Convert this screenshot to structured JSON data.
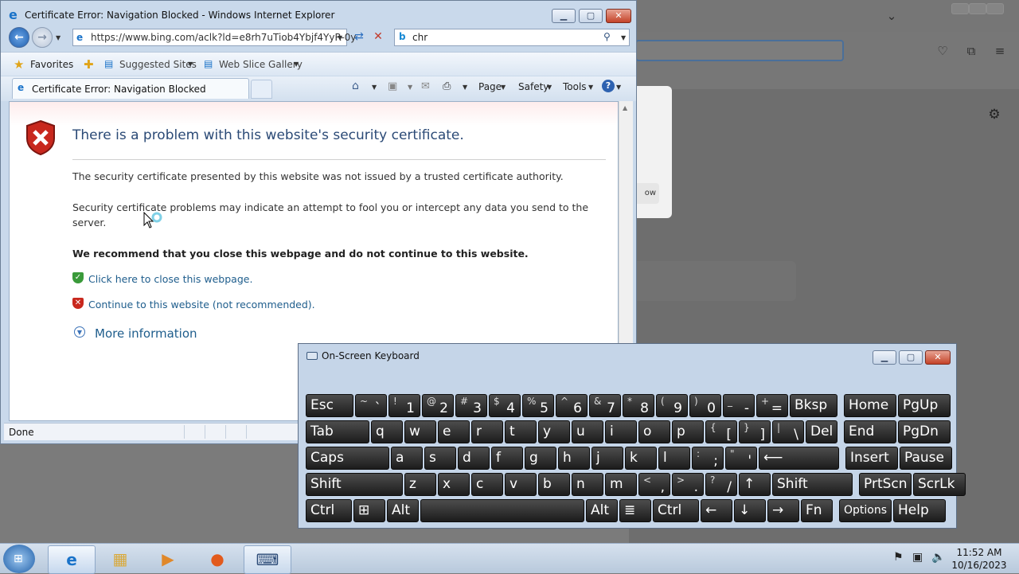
{
  "ie": {
    "title": "Certificate Error: Navigation Blocked - Windows Internet Explorer",
    "address": "https://www.bing.com/aclk?ld=e8rh7uTiob4Ybjf4YyR-0y",
    "search": "chr",
    "favorites": "Favorites",
    "suggested_sites": "Suggested Sites",
    "web_slice_gallery": "Web Slice Gallery",
    "tab_title": "Certificate Error: Navigation Blocked",
    "menu": {
      "page": "Page",
      "safety": "Safety",
      "tools": "Tools"
    },
    "heading": "There is a problem with this website's security certificate.",
    "para1": "The security certificate presented by this website was not issued by a trusted certificate authority.",
    "para2": "Security certificate problems may indicate an attempt to fool you or intercept any data you send to the server.",
    "recommend": "We recommend that you close this webpage and do not continue to this website.",
    "link_close": "Click here to close this webpage.",
    "link_continue": "Continue to this website (not recommended).",
    "more_info": "More information",
    "status": "Done"
  },
  "firefox": {
    "card_button": "ow"
  },
  "osk": {
    "title": "On-Screen Keyboard",
    "rows": [
      [
        {
          "m": "Esc"
        },
        {
          "s": "~",
          "m": "`"
        },
        {
          "s": "!",
          "m": "1"
        },
        {
          "s": "@",
          "m": "2"
        },
        {
          "s": "#",
          "m": "3"
        },
        {
          "s": "$",
          "m": "4"
        },
        {
          "s": "%",
          "m": "5"
        },
        {
          "s": "^",
          "m": "6"
        },
        {
          "s": "&",
          "m": "7"
        },
        {
          "s": "*",
          "m": "8"
        },
        {
          "s": "(",
          "m": "9"
        },
        {
          "s": ")",
          "m": "0"
        },
        {
          "s": "_",
          "m": "-"
        },
        {
          "s": "+",
          "m": "="
        },
        {
          "m": "Bksp"
        },
        {
          "m": "Home"
        },
        {
          "m": "PgUp"
        }
      ],
      [
        {
          "m": "Tab"
        },
        {
          "m": "q"
        },
        {
          "m": "w"
        },
        {
          "m": "e"
        },
        {
          "m": "r"
        },
        {
          "m": "t"
        },
        {
          "m": "y"
        },
        {
          "m": "u"
        },
        {
          "m": "i"
        },
        {
          "m": "o"
        },
        {
          "m": "p"
        },
        {
          "s": "{",
          "m": "["
        },
        {
          "s": "}",
          "m": "]"
        },
        {
          "s": "|",
          "m": "\\"
        },
        {
          "m": "Del"
        },
        {
          "m": "End"
        },
        {
          "m": "PgDn"
        }
      ],
      [
        {
          "m": "Caps"
        },
        {
          "m": "a"
        },
        {
          "m": "s"
        },
        {
          "m": "d"
        },
        {
          "m": "f"
        },
        {
          "m": "g"
        },
        {
          "m": "h"
        },
        {
          "m": "j"
        },
        {
          "m": "k"
        },
        {
          "m": "l"
        },
        {
          "s": ":",
          "m": ";"
        },
        {
          "s": "\"",
          "m": "'"
        },
        {
          "m": "⟵"
        },
        {
          "m": "Insert"
        },
        {
          "m": "Pause"
        }
      ],
      [
        {
          "m": "Shift"
        },
        {
          "m": "z"
        },
        {
          "m": "x"
        },
        {
          "m": "c"
        },
        {
          "m": "v"
        },
        {
          "m": "b"
        },
        {
          "m": "n"
        },
        {
          "m": "m"
        },
        {
          "s": "<",
          "m": ","
        },
        {
          "s": ">",
          "m": "."
        },
        {
          "s": "?",
          "m": "/"
        },
        {
          "m": "↑"
        },
        {
          "m": "Shift"
        },
        {
          "m": "PrtScn"
        },
        {
          "m": "ScrLk"
        }
      ],
      [
        {
          "m": "Ctrl"
        },
        {
          "m": "⊞"
        },
        {
          "m": "Alt"
        },
        {
          "m": ""
        },
        {
          "m": "Alt"
        },
        {
          "m": "≣"
        },
        {
          "m": "Ctrl"
        },
        {
          "m": "←"
        },
        {
          "m": "↓"
        },
        {
          "m": "→"
        },
        {
          "m": "Fn"
        },
        {
          "m": "Options"
        },
        {
          "m": "Help"
        }
      ]
    ]
  },
  "taskbar": {
    "time": "11:52 AM",
    "date": "10/16/2023"
  }
}
